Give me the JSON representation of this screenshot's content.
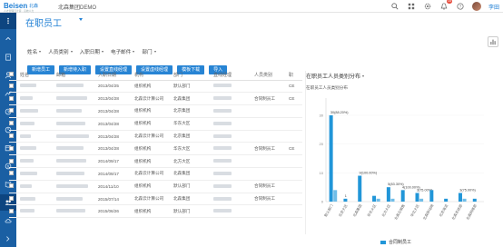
{
  "app": {
    "logo_main": "Beisen",
    "logo_cn": "北森",
    "logo_sub": "人才管理云计算 · 高效人力",
    "company": "北森集团DEMO",
    "user": "李田",
    "notification_count": "15"
  },
  "page": {
    "title": "在职员工"
  },
  "filters": [
    {
      "label": "姓名"
    },
    {
      "label": "人员类别"
    },
    {
      "label": "入职日期"
    },
    {
      "label": "电子邮件"
    },
    {
      "label": "部门"
    }
  ],
  "actions": [
    {
      "label": "新增员工"
    },
    {
      "label": "新增待入职"
    },
    {
      "label": "设置直线经理"
    },
    {
      "label": "设置虚线经理"
    },
    {
      "label": "模板下载"
    },
    {
      "label": "导入"
    }
  ],
  "table": {
    "columns": [
      "姓名",
      "邮箱",
      "入职日期",
      "机构",
      "部门",
      "直线经理",
      "人员类别",
      "职"
    ],
    "rows": [
      {
        "date": "2013/04/25",
        "org": "组织机构",
        "dept": "默认部门",
        "type": "",
        "tail": "CE"
      },
      {
        "date": "2013/04/28",
        "org": "北森云计算公司",
        "dept": "北森集团",
        "type": "合同制员工",
        "tail": "CE"
      },
      {
        "date": "2013/04/28",
        "org": "组织机构",
        "dept": "北京集团",
        "type": "",
        "tail": ""
      },
      {
        "date": "2013/04/28",
        "org": "组织机构",
        "dept": "华东大区",
        "type": "",
        "tail": ""
      },
      {
        "date": "2013/04/28",
        "org": "北森云计算公司",
        "dept": "北京集团",
        "type": "",
        "tail": ""
      },
      {
        "date": "2013/04/28",
        "org": "组织机构",
        "dept": "华东大区",
        "type": "合同制员工",
        "tail": "CE"
      },
      {
        "date": "2014/09/17",
        "org": "组织机构",
        "dept": "北方大区",
        "type": "",
        "tail": ""
      },
      {
        "date": "2014/09/17",
        "org": "北森云计算公司",
        "dept": "北森集团",
        "type": "",
        "tail": ""
      },
      {
        "date": "2014/11/10",
        "org": "组织机构",
        "dept": "默认部门",
        "type": "合同制员工",
        "tail": ""
      },
      {
        "date": "2015/07/14",
        "org": "北森云计算公司",
        "dept": "北森集团",
        "type": "合同制员工",
        "tail": ""
      },
      {
        "date": "2015/06/26",
        "org": "组织机构",
        "dept": "默认部门",
        "type": "",
        "tail": ""
      }
    ]
  },
  "chart_panel": {
    "title": "在职员工人员类别分布",
    "subtitle": "在职员工人员类别分布"
  },
  "chart_data": {
    "type": "bar",
    "categories": [
      "默认部门",
      "北京大区",
      "北森集团",
      "华东大区",
      "北方大区",
      "北森云销售",
      "华北大区",
      "北森移动端",
      "北京海淀",
      "北森系统部",
      "北森网络部"
    ],
    "series": [
      {
        "name": "合同制员工",
        "values": [
          30,
          1,
          9,
          2,
          5,
          4,
          3,
          4,
          1,
          3,
          1
        ],
        "labels": [
          "30(88.20%)",
          "1",
          "9(100.00%)",
          "",
          "5(83.30%)",
          "4(100.00%)",
          "3(75.00%)",
          "",
          "",
          "3(75.00%)",
          ""
        ]
      },
      {
        "name": "",
        "values": [
          4,
          0,
          0,
          1,
          1,
          0,
          1,
          0,
          0,
          1,
          0
        ],
        "labels": []
      }
    ],
    "y_tick_labels": [
      "30",
      "20",
      "10",
      "0"
    ],
    "ylim": [
      0,
      36
    ],
    "legend": "bottom"
  },
  "colors": {
    "primary": "#2784d4",
    "sidebar": "#1a5fa3",
    "bar": "#2196d8"
  }
}
